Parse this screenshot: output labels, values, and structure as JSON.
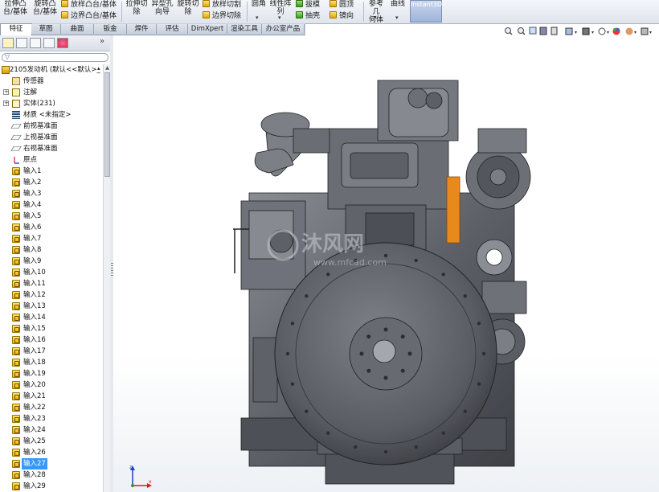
{
  "ribbon": {
    "group1": [
      "拉伸凸",
      "台/基体"
    ],
    "group2": [
      "旋转凸",
      "台/基体"
    ],
    "loft_boss": "放样凸台/基体",
    "boundary_boss": "边界凸台/基体",
    "extrude_cut": [
      "拉伸切",
      "除"
    ],
    "hole_wizard": [
      "异型孔",
      "向导"
    ],
    "revolve_cut": [
      "旋转切",
      "除"
    ],
    "loft_cut": "放样切割",
    "boundary_cut": "边界切除",
    "fillet": "圆角",
    "linear_pattern": [
      "线性阵",
      "列"
    ],
    "draft": "拔模",
    "shell": "抽壳",
    "dome": "圆顶",
    "mirror": "镜向",
    "ref_geometry": [
      "参考几",
      "何体"
    ],
    "curves": "曲线",
    "instant3d": "Instant3D"
  },
  "tabs": [
    "特征",
    "草图",
    "曲面",
    "钣金",
    "焊件",
    "评估",
    "DimXpert",
    "渲染工具",
    "办公室产品"
  ],
  "active_tab": "特征",
  "tree": {
    "root": "2105发动机 (默认<<默认>_",
    "items": [
      {
        "label": "传感器",
        "icon": "sensor-icon",
        "expand": false
      },
      {
        "label": "注解",
        "icon": "annotation-icon",
        "expand": true
      },
      {
        "label": "实体(231)",
        "icon": "solid-bodies-icon",
        "expand": true
      },
      {
        "label": "材质 <未指定>",
        "icon": "material-icon",
        "expand": false
      },
      {
        "label": "前视基准面",
        "icon": "plane-icon",
        "expand": false
      },
      {
        "label": "上视基准面",
        "icon": "plane-icon",
        "expand": false
      },
      {
        "label": "右视基准面",
        "icon": "plane-icon",
        "expand": false
      },
      {
        "label": "原点",
        "icon": "origin-icon",
        "expand": false
      }
    ],
    "features": [
      "输入1",
      "输入2",
      "输入3",
      "输入4",
      "输入5",
      "输入6",
      "输入7",
      "输入8",
      "输入9",
      "输入10",
      "输入11",
      "输入12",
      "输入13",
      "输入14",
      "输入15",
      "输入16",
      "输入17",
      "输入18",
      "输入19",
      "输入20",
      "输入21",
      "输入22",
      "输入23",
      "输入24",
      "输入25",
      "输入26",
      "输入27",
      "输入28",
      "输入29"
    ],
    "selected": "输入27"
  },
  "watermark": {
    "brand": "沐风网",
    "url": "www.mfcad.com"
  },
  "colors": {
    "model": "#5a5d64",
    "highlight": "#e8891e",
    "selection": "#3399ff"
  }
}
